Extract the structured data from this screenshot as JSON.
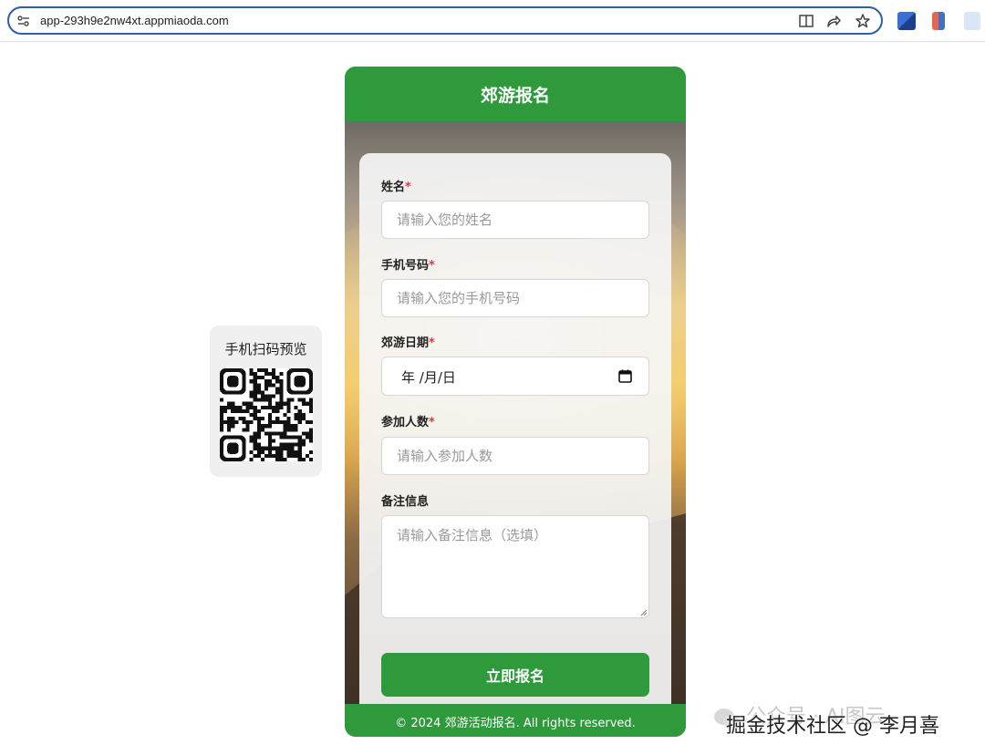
{
  "browser": {
    "url": "app-293h9e2nw4xt.appmiaoda.com",
    "site_info_icon": "tune-icon",
    "tools": [
      "reader-mode-icon",
      "share-icon",
      "bookmark-star-icon"
    ]
  },
  "qr_panel": {
    "title": "手机扫码预览"
  },
  "app": {
    "header_title": "郊游报名",
    "colors": {
      "primary": "#2e9a3c",
      "required": "#e23a3a"
    },
    "form": {
      "name": {
        "label": "姓名",
        "required_mark": "*",
        "placeholder": "请输入您的姓名"
      },
      "phone": {
        "label": "手机号码",
        "required_mark": "*",
        "placeholder": "请输入您的手机号码"
      },
      "date": {
        "label": "郊游日期",
        "required_mark": "*",
        "value": "年 /月/日"
      },
      "people": {
        "label": "参加人数",
        "required_mark": "*",
        "placeholder": "请输入参加人数"
      },
      "notes": {
        "label": "备注信息",
        "placeholder": "请输入备注信息（选填）"
      },
      "submit_label": "立即报名"
    },
    "footer": "© 2024 郊游活动报名. All rights reserved."
  },
  "watermark": {
    "faded_text": "公众号 · AI图云",
    "text": "掘金技术社区 @ 李月喜"
  }
}
